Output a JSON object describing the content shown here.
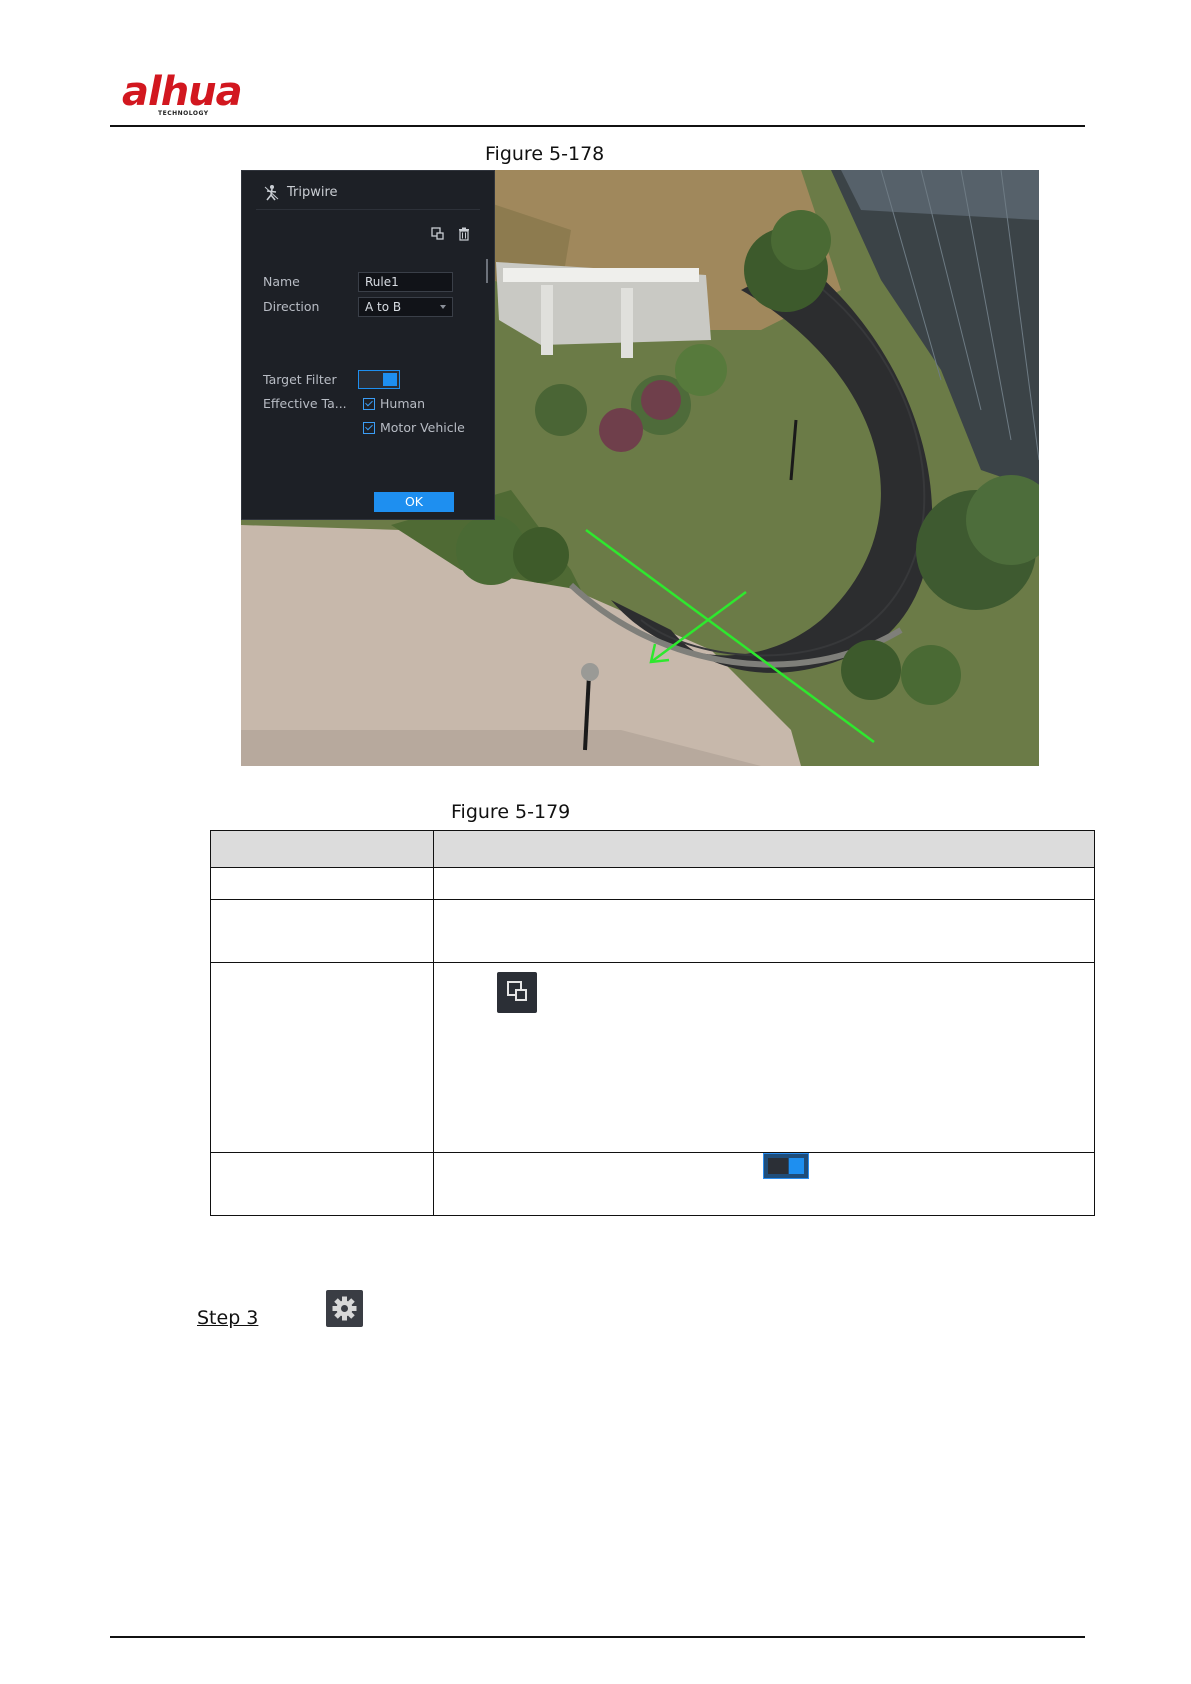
{
  "header": {
    "logo_text": "alhua",
    "logo_subtext": "TECHNOLOGY"
  },
  "figure_178": {
    "caption": "Figure 5-178",
    "dialog": {
      "title": "Tripwire",
      "fields": {
        "name_label": "Name",
        "name_value": "Rule1",
        "direction_label": "Direction",
        "direction_value": "A to B",
        "target_filter_label": "Target Filter",
        "target_filter_enabled": true,
        "effective_target_label": "Effective Ta...",
        "targets": [
          {
            "label": "Human",
            "checked": true
          },
          {
            "label": "Motor Vehicle",
            "checked": true
          }
        ]
      },
      "ok_label": "OK",
      "icons": [
        "tripwire-icon",
        "copy-icon",
        "delete-icon"
      ]
    },
    "accent_color": "#1e8ff0",
    "line_color": "#2ee82e"
  },
  "figure_179": {
    "caption": "Figure 5-179",
    "table_rows": 6,
    "icons": [
      "copy-icon",
      "toggle-icon"
    ]
  },
  "step": {
    "label": "Step 3",
    "icon": "gear-icon"
  }
}
